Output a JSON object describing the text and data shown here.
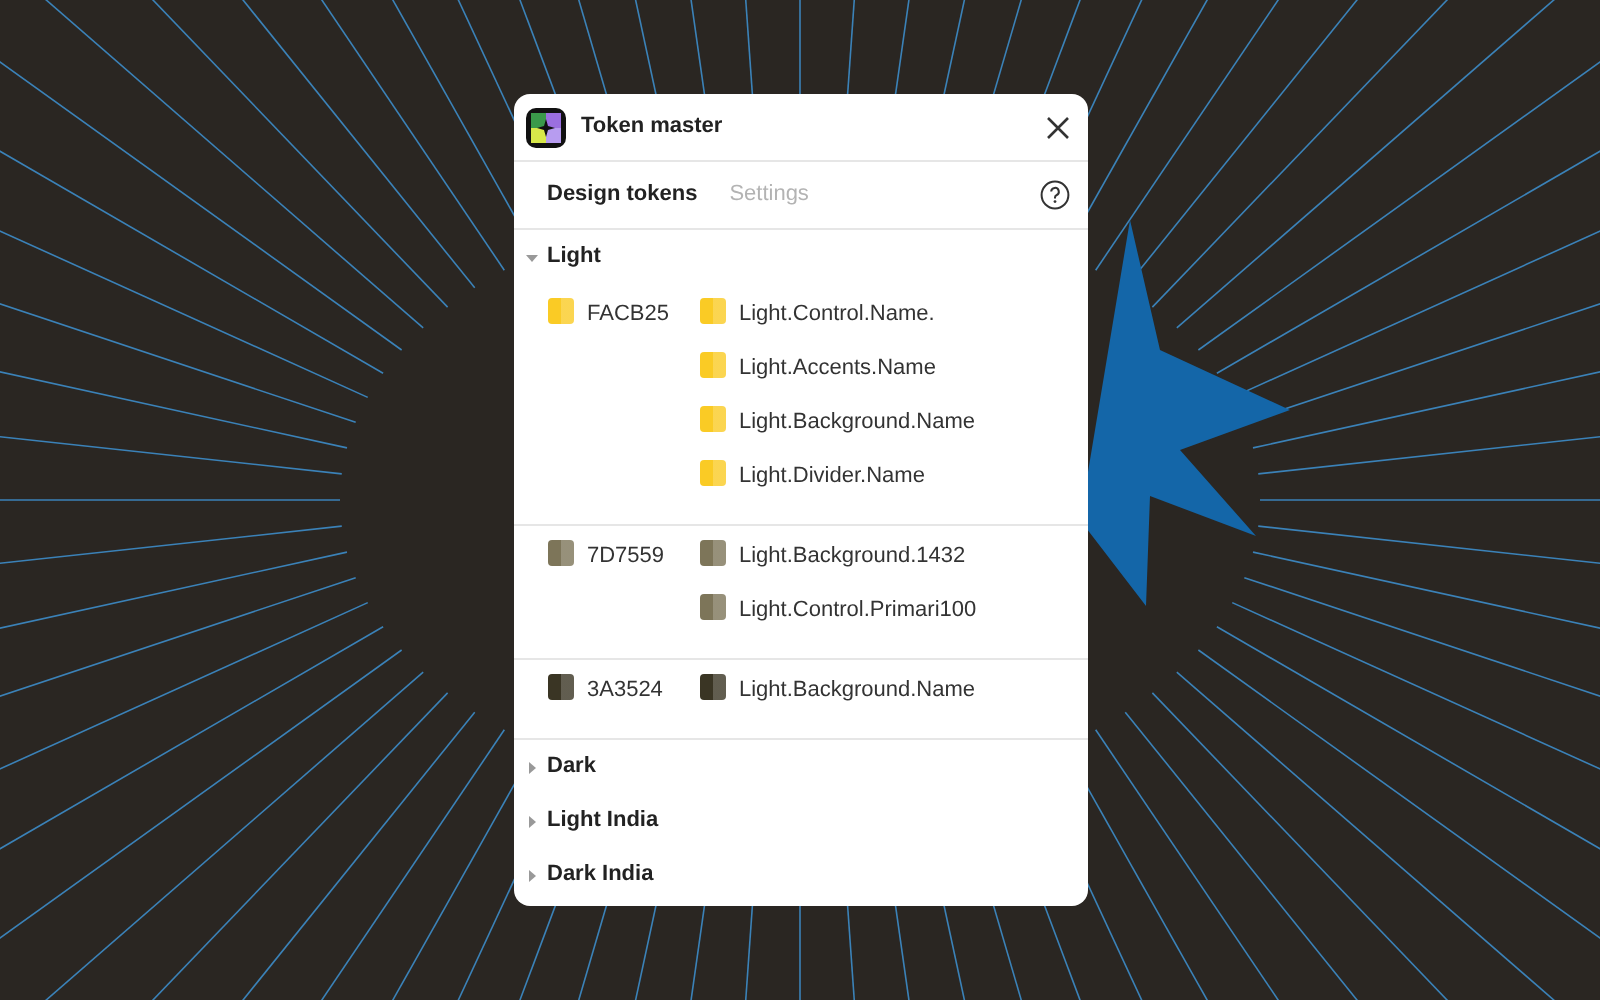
{
  "window": {
    "title": "Token master"
  },
  "tabs": [
    {
      "label": "Design tokens",
      "selected": true
    },
    {
      "label": "Settings",
      "selected": false
    }
  ],
  "groups": [
    {
      "name": "Light",
      "expanded": true,
      "colors": [
        {
          "hex": "FACB25",
          "color": "#facb25",
          "tokens": [
            "Light.Control.Name.",
            "Light.Accents.Name",
            "Light.Background.Name",
            "Light.Divider.Name"
          ]
        },
        {
          "hex": "7D7559",
          "color": "#7d7559",
          "tokens": [
            "Light.Background.1432",
            "Light.Control.Primari100"
          ]
        },
        {
          "hex": "3A3524",
          "color": "#3a3524",
          "tokens": [
            "Light.Background.Name"
          ]
        }
      ]
    },
    {
      "name": "Dark",
      "expanded": false
    },
    {
      "name": "Light India",
      "expanded": false
    },
    {
      "name": "Dark India",
      "expanded": false
    }
  ]
}
